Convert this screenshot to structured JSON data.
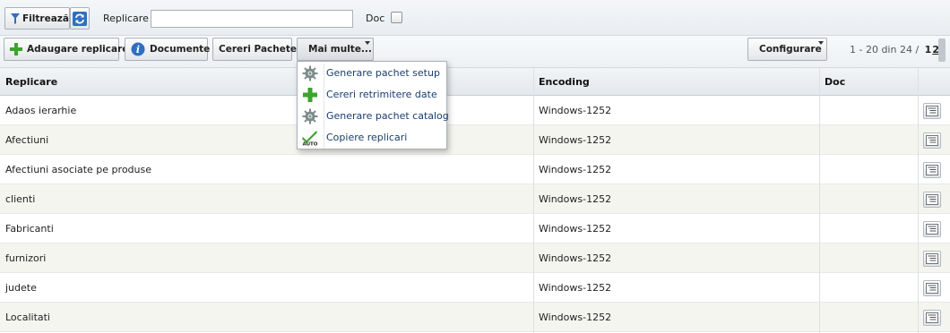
{
  "filter_bar": {
    "filter_button": "Filtrează",
    "replicare_label": "Replicare",
    "replicare_value": "",
    "doc_label": "Doc"
  },
  "toolbar": {
    "add_button": "Adaugare replicare",
    "docs_button": "Documente",
    "package_requests_button": "Cereri Pachete",
    "more_button": "Mai multe...",
    "configure_button": "Configurare",
    "pager_text": "1 - 20 din 24 /",
    "page_current": "1",
    "page_next": "2"
  },
  "more_menu": {
    "items": [
      {
        "label": "Generare pachet setup",
        "icon": "gear-icon"
      },
      {
        "label": "Cereri retrimitere date",
        "icon": "plus-icon"
      },
      {
        "label": "Generare pachet catalog",
        "icon": "gear-icon"
      },
      {
        "label": "Copiere replicari",
        "icon": "auto-check-icon"
      }
    ]
  },
  "table": {
    "columns": [
      "Replicare",
      "Encoding",
      "Doc",
      ""
    ],
    "rows": [
      {
        "replicare": "Adaos ierarhie",
        "encoding": "Windows-1252",
        "doc": ""
      },
      {
        "replicare": "Afectiuni",
        "encoding": "Windows-1252",
        "doc": ""
      },
      {
        "replicare": "Afectiuni asociate pe produse",
        "encoding": "Windows-1252",
        "doc": ""
      },
      {
        "replicare": "clienti",
        "encoding": "Windows-1252",
        "doc": ""
      },
      {
        "replicare": "Fabricanti",
        "encoding": "Windows-1252",
        "doc": ""
      },
      {
        "replicare": "furnizori",
        "encoding": "Windows-1252",
        "doc": ""
      },
      {
        "replicare": "judete",
        "encoding": "Windows-1252",
        "doc": ""
      },
      {
        "replicare": "Localitati",
        "encoding": "Windows-1252",
        "doc": ""
      }
    ]
  },
  "colors": {
    "header_bg": "#e4e8ec",
    "row_alt_bg": "#f5f5f0",
    "menu_text": "#1a3d6e",
    "add_icon_green": "#3aa52d",
    "info_icon_blue": "#2f6fc0"
  }
}
